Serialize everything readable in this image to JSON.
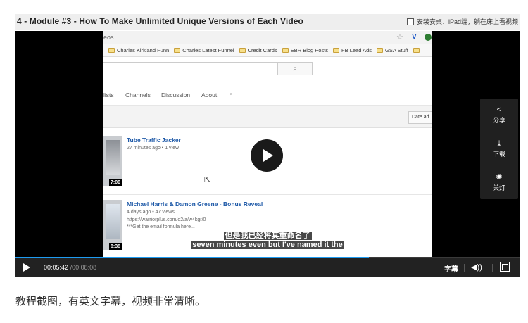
{
  "title_bar": {
    "title": "4 - Module #3 - How To Make Unlimited Unique Versions of Each Video",
    "lazy_mode_label": "安装安桌、iPad端，躺在床上看视频"
  },
  "browser": {
    "address_text": "eos",
    "bookmarks": [
      "Charles Kirkland Funn",
      "Charles Latest Funnel",
      "Credit Cards",
      "EBR Blog Posts",
      "FB Lead Ads",
      "GSA Stuff"
    ],
    "nav_tabs": [
      "lists",
      "Channels",
      "Discussion",
      "About"
    ],
    "sort_label": "Date ad",
    "videos": [
      {
        "title": "Tube Traffic Jacker",
        "meta": "27 minutes ago • 1 view",
        "duration": "7:00"
      },
      {
        "title": "Michael Harris & Damon Greene - Bonus Reveal",
        "meta": "4 days ago • 47 views",
        "url": "https://warriorplus.com/o2/a/w4kgr/0",
        "desc": "***Get the email formula here...",
        "duration": "8:38"
      }
    ]
  },
  "subtitles": {
    "chinese": "但是我已经将其重命名了",
    "english": "seven minutes even but I've named it the"
  },
  "side_panel": [
    {
      "icon": "share-icon",
      "label": "分享"
    },
    {
      "icon": "download-icon",
      "label": "下载"
    },
    {
      "icon": "light-icon",
      "label": "关灯"
    }
  ],
  "controls": {
    "current_time": "00:05:42",
    "duration": "/00:08:08",
    "progress": 0.701,
    "captions_label": "字幕"
  },
  "caption": "教程截图，有英文字幕，视频非常清晰。"
}
